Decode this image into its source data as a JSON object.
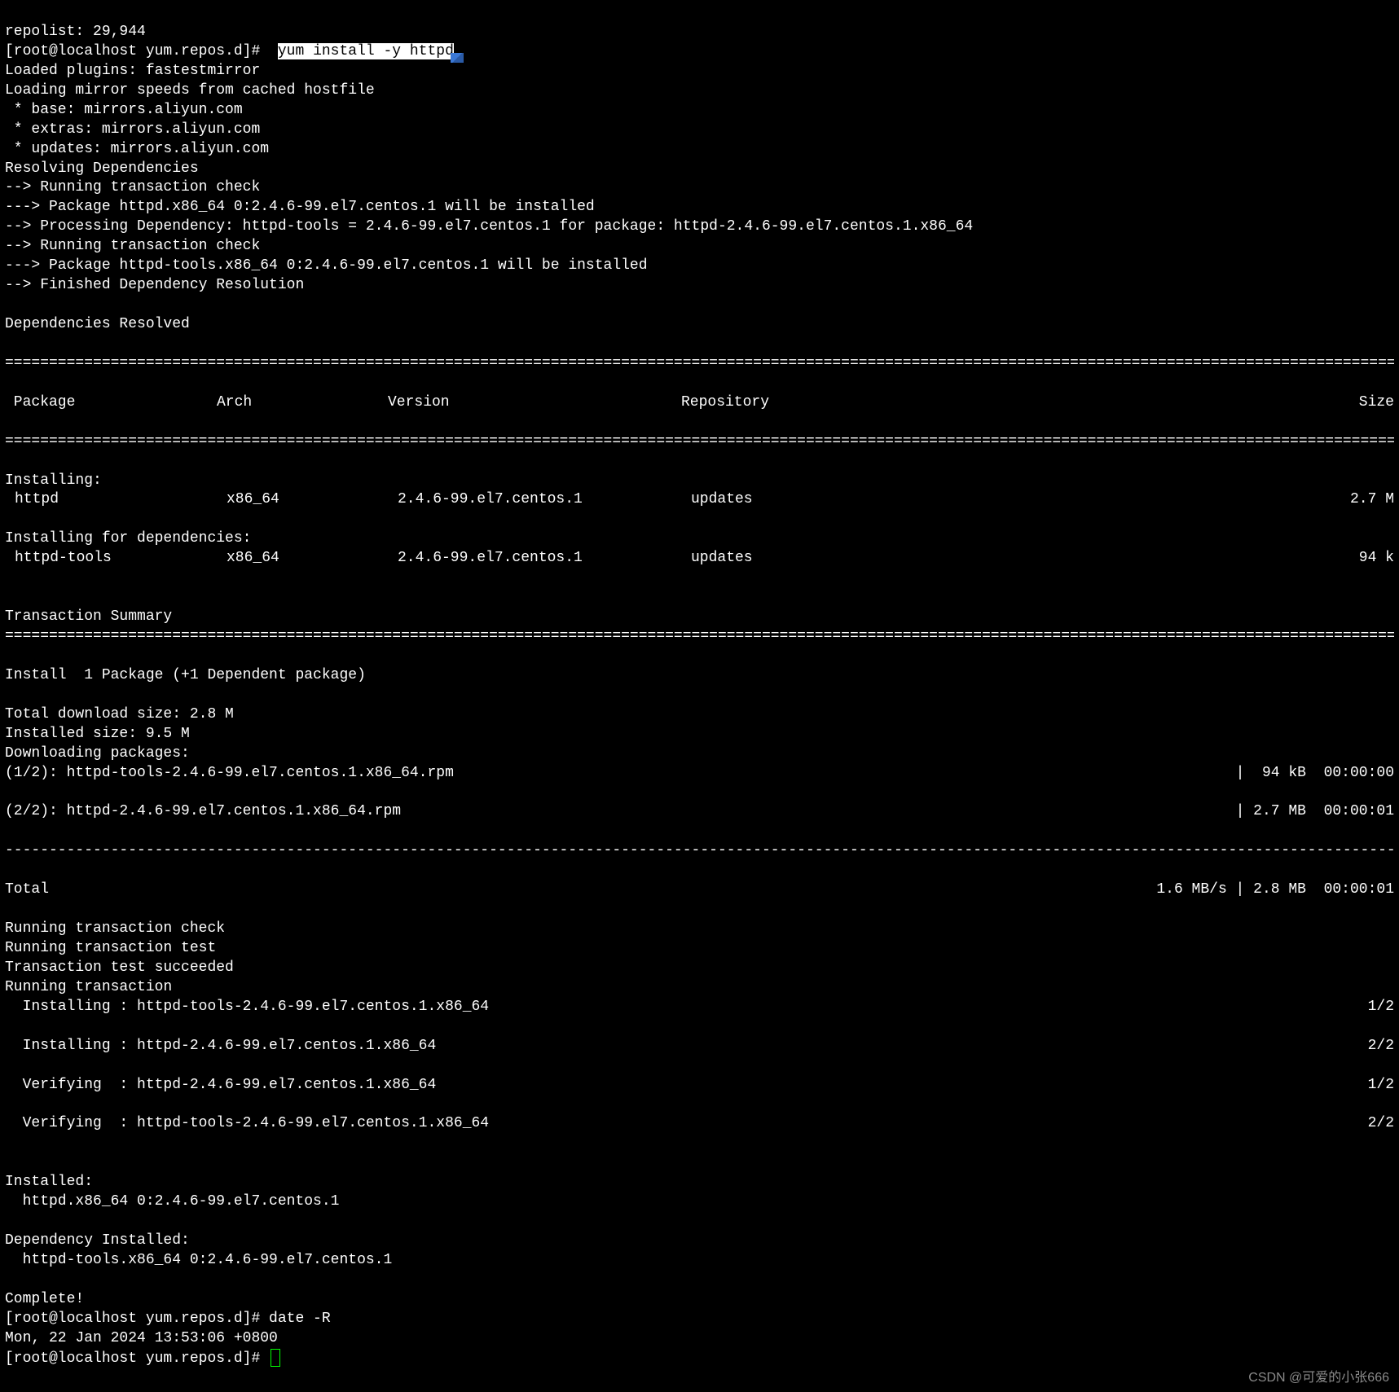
{
  "pre": {
    "repolist": "repolist: 29,944",
    "prompt1": "[root@localhost yum.repos.d]#",
    "cmd": "yum install -y httpd",
    "l1": "Loaded plugins: fastestmirror",
    "l2": "Loading mirror speeds from cached hostfile",
    "l3": " * base: mirrors.aliyun.com",
    "l4": " * extras: mirrors.aliyun.com",
    "l5": " * updates: mirrors.aliyun.com",
    "l6": "Resolving Dependencies",
    "l7": "--> Running transaction check",
    "l8": "---> Package httpd.x86_64 0:2.4.6-99.el7.centos.1 will be installed",
    "l9": "--> Processing Dependency: httpd-tools = 2.4.6-99.el7.centos.1 for package: httpd-2.4.6-99.el7.centos.1.x86_64",
    "l10": "--> Running transaction check",
    "l11": "---> Package httpd-tools.x86_64 0:2.4.6-99.el7.centos.1 will be installed",
    "l12": "--> Finished Dependency Resolution",
    "depres": "Dependencies Resolved"
  },
  "table": {
    "rule_eq": "==================================================================================================================================================================",
    "rule_dash": "------------------------------------------------------------------------------------------------------------------------------------------------------------------",
    "headers": [
      " Package",
      "Arch",
      "Version",
      "Repository",
      "Size"
    ],
    "installing_label": "Installing:",
    "deps_label": "Installing for dependencies:",
    "rows": [
      {
        "pkg": "httpd",
        "arch": "x86_64",
        "ver": "2.4.6-99.el7.centos.1",
        "repo": "updates",
        "size": "2.7 M"
      },
      {
        "pkg": "httpd-tools",
        "arch": "x86_64",
        "ver": "2.4.6-99.el7.centos.1",
        "repo": "updates",
        "size": "94 k"
      }
    ]
  },
  "summary": {
    "title": "Transaction Summary",
    "install_line": "Install  1 Package (+1 Dependent package)",
    "total_dl": "Total download size: 2.8 M",
    "installed_size": "Installed size: 9.5 M"
  },
  "dl": {
    "header": "Downloading packages:",
    "rows": [
      {
        "left": "(1/2): httpd-tools-2.4.6-99.el7.centos.1.x86_64.rpm",
        "right": "|  94 kB  00:00:00"
      },
      {
        "left": "(2/2): httpd-2.4.6-99.el7.centos.1.x86_64.rpm",
        "right": "| 2.7 MB  00:00:01"
      }
    ],
    "total": {
      "left": "Total",
      "right": "1.6 MB/s | 2.8 MB  00:00:01"
    }
  },
  "trans": {
    "l1": "Running transaction check",
    "l2": "Running transaction test",
    "l3": "Transaction test succeeded",
    "l4": "Running transaction",
    "steps": [
      {
        "text": "  Installing : httpd-tools-2.4.6-99.el7.centos.1.x86_64",
        "n": "1/2"
      },
      {
        "text": "  Installing : httpd-2.4.6-99.el7.centos.1.x86_64",
        "n": "2/2"
      },
      {
        "text": "  Verifying  : httpd-2.4.6-99.el7.centos.1.x86_64",
        "n": "1/2"
      },
      {
        "text": "  Verifying  : httpd-tools-2.4.6-99.el7.centos.1.x86_64",
        "n": "2/2"
      }
    ]
  },
  "result": {
    "installed_label": "Installed:",
    "installed_pkg": "  httpd.x86_64 0:2.4.6-99.el7.centos.1",
    "dep_label": "Dependency Installed:",
    "dep_pkg": "  httpd-tools.x86_64 0:2.4.6-99.el7.centos.1",
    "complete": "Complete!"
  },
  "post": {
    "prompt2": "[root@localhost yum.repos.d]# date -R",
    "date_out": "Mon, 22 Jan 2024 13:53:06 +0800",
    "prompt3": "[root@localhost yum.repos.d]# "
  },
  "watermark": "CSDN @可爱的小张666"
}
